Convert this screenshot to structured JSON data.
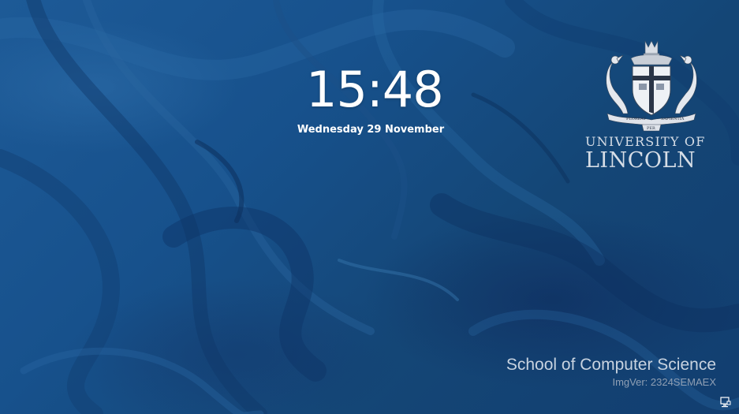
{
  "lock_screen": {
    "time": "15:48",
    "date": "Wednesday 29 November",
    "background_color": "#184c85"
  },
  "branding": {
    "crest_icon": "university-crest-icon",
    "name_line1": "UNIVERSITY OF",
    "name_line2": "LINCOLN",
    "motto_left": "FLOREAT",
    "motto_right": "SAPIENTIA",
    "motto_bottom": "PER"
  },
  "footer": {
    "school": "School of Computer Science",
    "image_version": "ImgVer: 2324SEMAEX"
  },
  "tray": {
    "network_icon": "network-status-icon"
  }
}
